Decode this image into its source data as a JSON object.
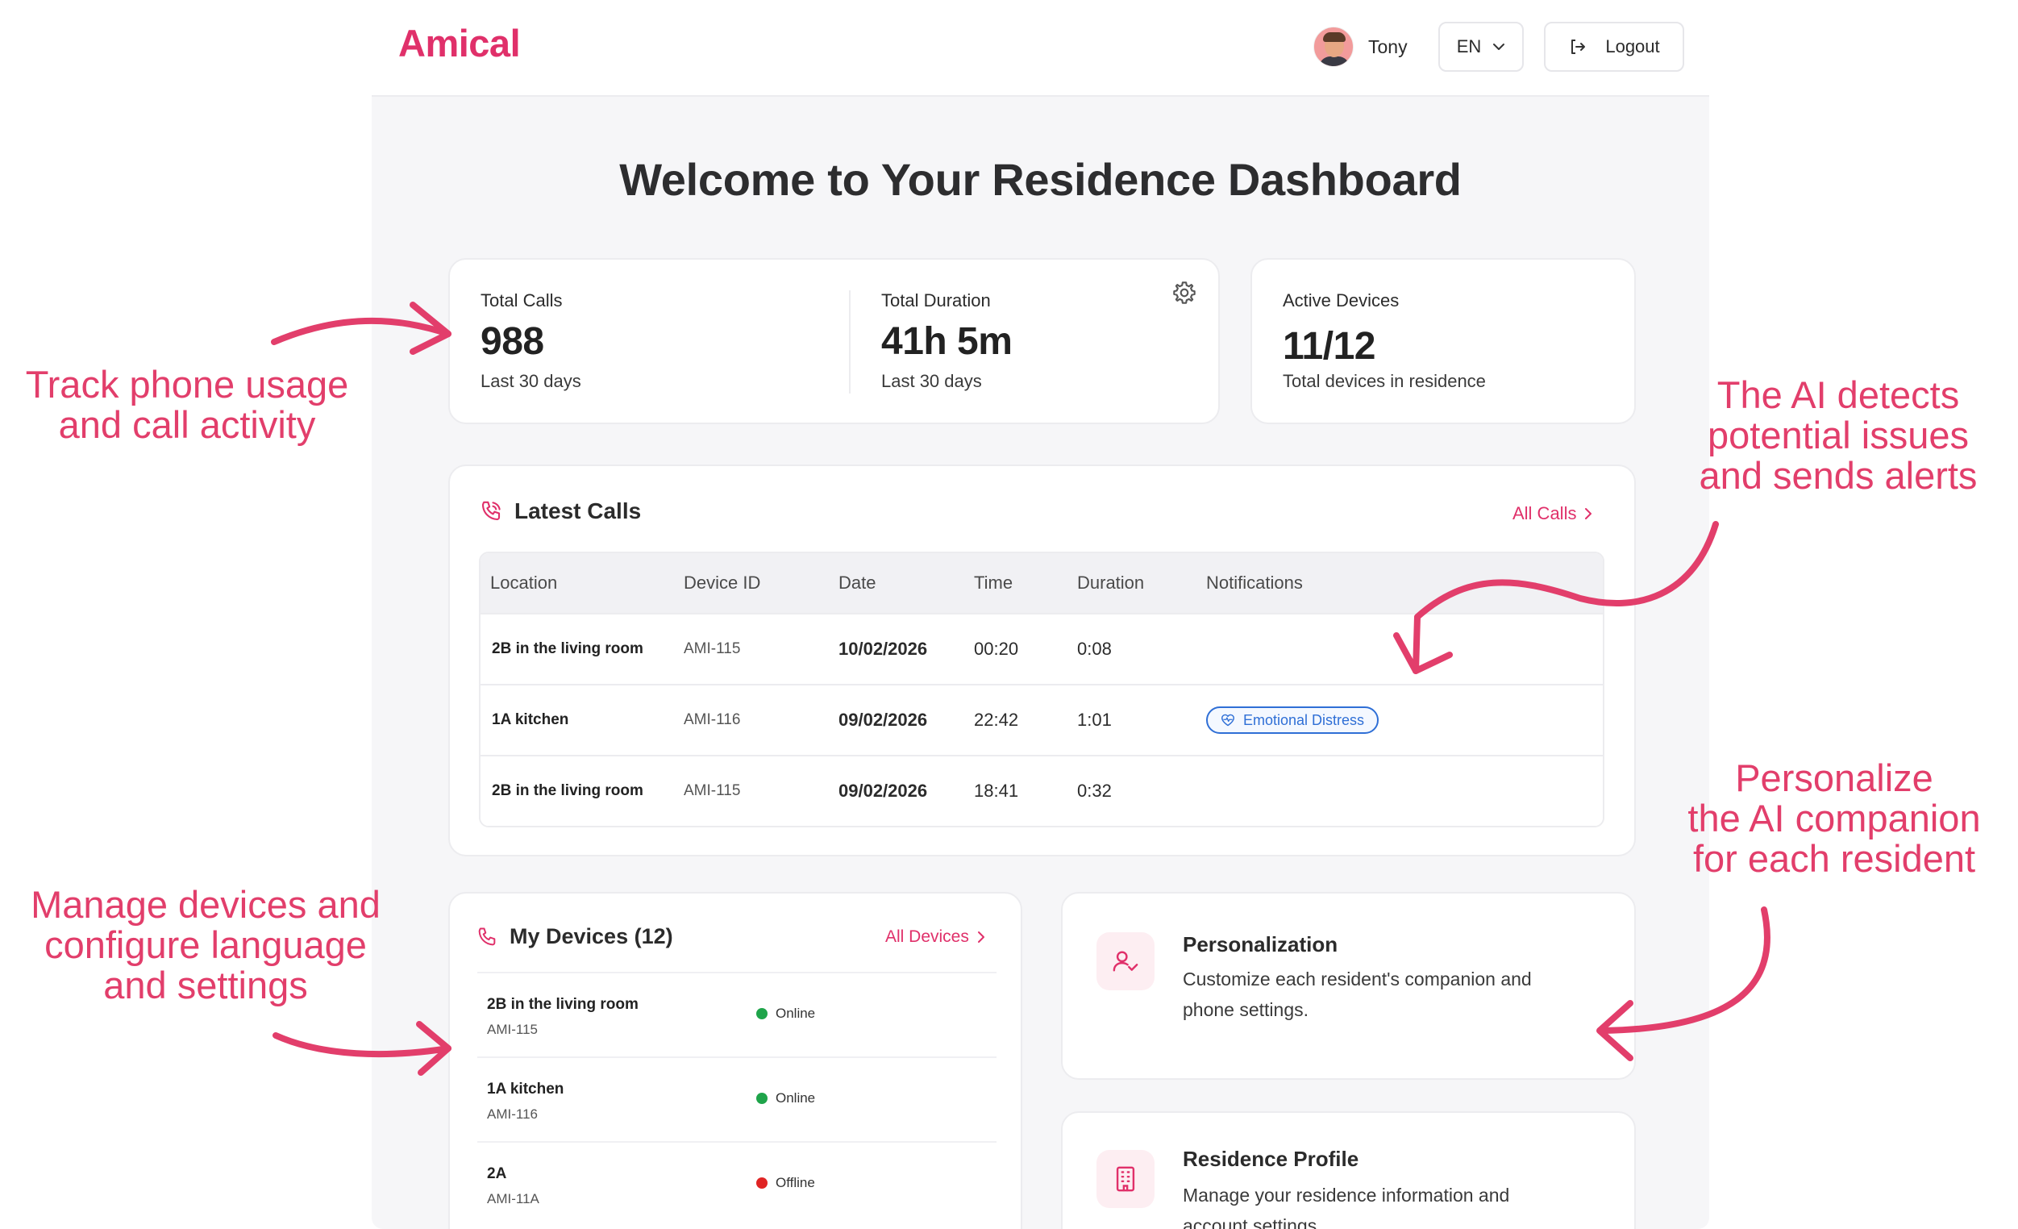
{
  "header": {
    "logo": "Amical",
    "user_name": "Tony",
    "language": "EN",
    "logout_label": "Logout"
  },
  "page_title": "Welcome to Your Residence Dashboard",
  "stats": {
    "total_calls": {
      "label": "Total Calls",
      "value": "988",
      "sub": "Last 30 days"
    },
    "total_duration": {
      "label": "Total Duration",
      "value": "41h 5m",
      "sub": "Last 30 days"
    },
    "active_devices": {
      "label": "Active Devices",
      "value": "11/12",
      "sub": "Total devices in residence"
    }
  },
  "latest_calls": {
    "title": "Latest Calls",
    "all_link": "All Calls",
    "columns": [
      "Location",
      "Device ID",
      "Date",
      "Time",
      "Duration",
      "Notifications"
    ],
    "rows": [
      {
        "location": "2B in the living room",
        "device_id": "AMI-115",
        "date": "10/02/2026",
        "time": "00:20",
        "duration": "0:08",
        "notification": ""
      },
      {
        "location": "1A kitchen",
        "device_id": "AMI-116",
        "date": "09/02/2026",
        "time": "22:42",
        "duration": "1:01",
        "notification": "Emotional Distress"
      },
      {
        "location": "2B in the living room",
        "device_id": "AMI-115",
        "date": "09/02/2026",
        "time": "18:41",
        "duration": "0:32",
        "notification": ""
      }
    ]
  },
  "devices": {
    "title": "My Devices (12)",
    "all_link": "All Devices",
    "items": [
      {
        "name": "2B in the living room",
        "id": "AMI-115",
        "status": "Online"
      },
      {
        "name": "1A kitchen",
        "id": "AMI-116",
        "status": "Online"
      },
      {
        "name": "2A",
        "id": "AMI-11A",
        "status": "Offline"
      }
    ]
  },
  "features": {
    "personalization": {
      "title": "Personalization",
      "desc_line1": "Customize each resident's companion and",
      "desc_line2": "phone settings."
    },
    "residence_profile": {
      "title": "Residence Profile",
      "desc_line1": "Manage your residence information and",
      "desc_line2": "account settings"
    }
  },
  "annotations": {
    "track": [
      "Track phone usage",
      "and call activity"
    ],
    "ai_alerts": [
      "The AI detects",
      "potential issues",
      "and sends alerts"
    ],
    "personalize": [
      "Personalize",
      "the AI companion",
      "for each resident"
    ],
    "manage": [
      "Manage devices and",
      "configure language",
      "and settings"
    ]
  },
  "colors": {
    "brand": "#e0306a",
    "annotation": "#e23e6b",
    "online": "#1fa44a",
    "offline": "#e02424",
    "alert_badge": "#2f6fd6"
  }
}
